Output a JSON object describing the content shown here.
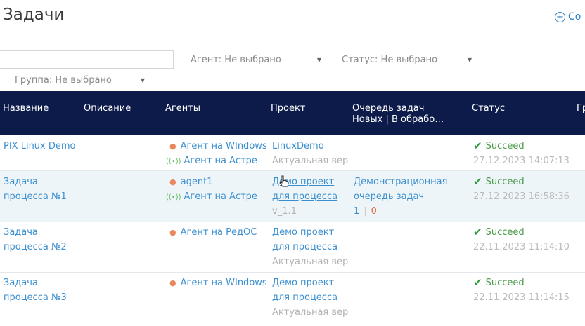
{
  "page": {
    "title": "Задачи",
    "create_label": "Со"
  },
  "filters": {
    "search_placeholder": "",
    "agent": "Агент: Не выбрано",
    "status": "Статус: Не выбрано",
    "group": "Группа: Не выбрано"
  },
  "table": {
    "headers": {
      "name": "Название",
      "description": "Описание",
      "agents": "Агенты",
      "project": "Проект",
      "queue_line1": "Очередь задач",
      "queue_line2": "Новых | В обрабо…",
      "status": "Статус",
      "group": "Гр"
    },
    "rows": [
      {
        "name_line1": "PIX Linux Demo",
        "name_line2": "",
        "agents": [
          "Агент на WIndows",
          "Агент на Астре"
        ],
        "project_line1": "LinuxDemo",
        "project_line2": "",
        "project_version": "Актуальная вер",
        "queue_line1": "",
        "queue_line2": "",
        "queue_new": "",
        "queue_proc": "",
        "status": "Succeed",
        "timestamp": "27.12.2023 14:07:13"
      },
      {
        "name_line1": "Задача",
        "name_line2": "процесса №1",
        "agents": [
          "agent1",
          "Агент на Астре"
        ],
        "project_line1": "Демо проект",
        "project_line2": "для процесса",
        "project_version": "v_1.1",
        "queue_line1": "Демонстрационная",
        "queue_line2": "очередь задач",
        "queue_new": "1",
        "queue_proc": "0",
        "status": "Succeed",
        "timestamp": "27.12.2023 16:58:36"
      },
      {
        "name_line1": "Задача",
        "name_line2": "процесса №2",
        "agents": [
          "Агент на РедОС"
        ],
        "project_line1": "Демо проект",
        "project_line2": "для процесса",
        "project_version": "Актуальная вер",
        "queue_line1": "",
        "queue_line2": "",
        "queue_new": "",
        "queue_proc": "",
        "status": "Succeed",
        "timestamp": "22.11.2023 11:14:10"
      },
      {
        "name_line1": "Задача",
        "name_line2": "процесса №3",
        "agents": [
          "Агент на WIndows"
        ],
        "project_line1": "Демо проект",
        "project_line2": "для процесса",
        "project_version": "Актуальная вер",
        "queue_line1": "",
        "queue_line2": "",
        "queue_new": "",
        "queue_proc": "",
        "status": "Succeed",
        "timestamp": "22.11.2023 11:14:15"
      }
    ]
  },
  "colors": {
    "header_bg": "#0d1b4b",
    "link": "#3c8fcf",
    "success": "#2e9b3e",
    "agent_dot": "#e8865d",
    "highlight_row": "#eef5f8"
  },
  "icons": {
    "create": "plus-circle-icon",
    "status_ok": "check-icon",
    "agent_offline": "dot-icon",
    "agent_online": "signal-icon",
    "cursor": "hand-pointer-icon"
  }
}
